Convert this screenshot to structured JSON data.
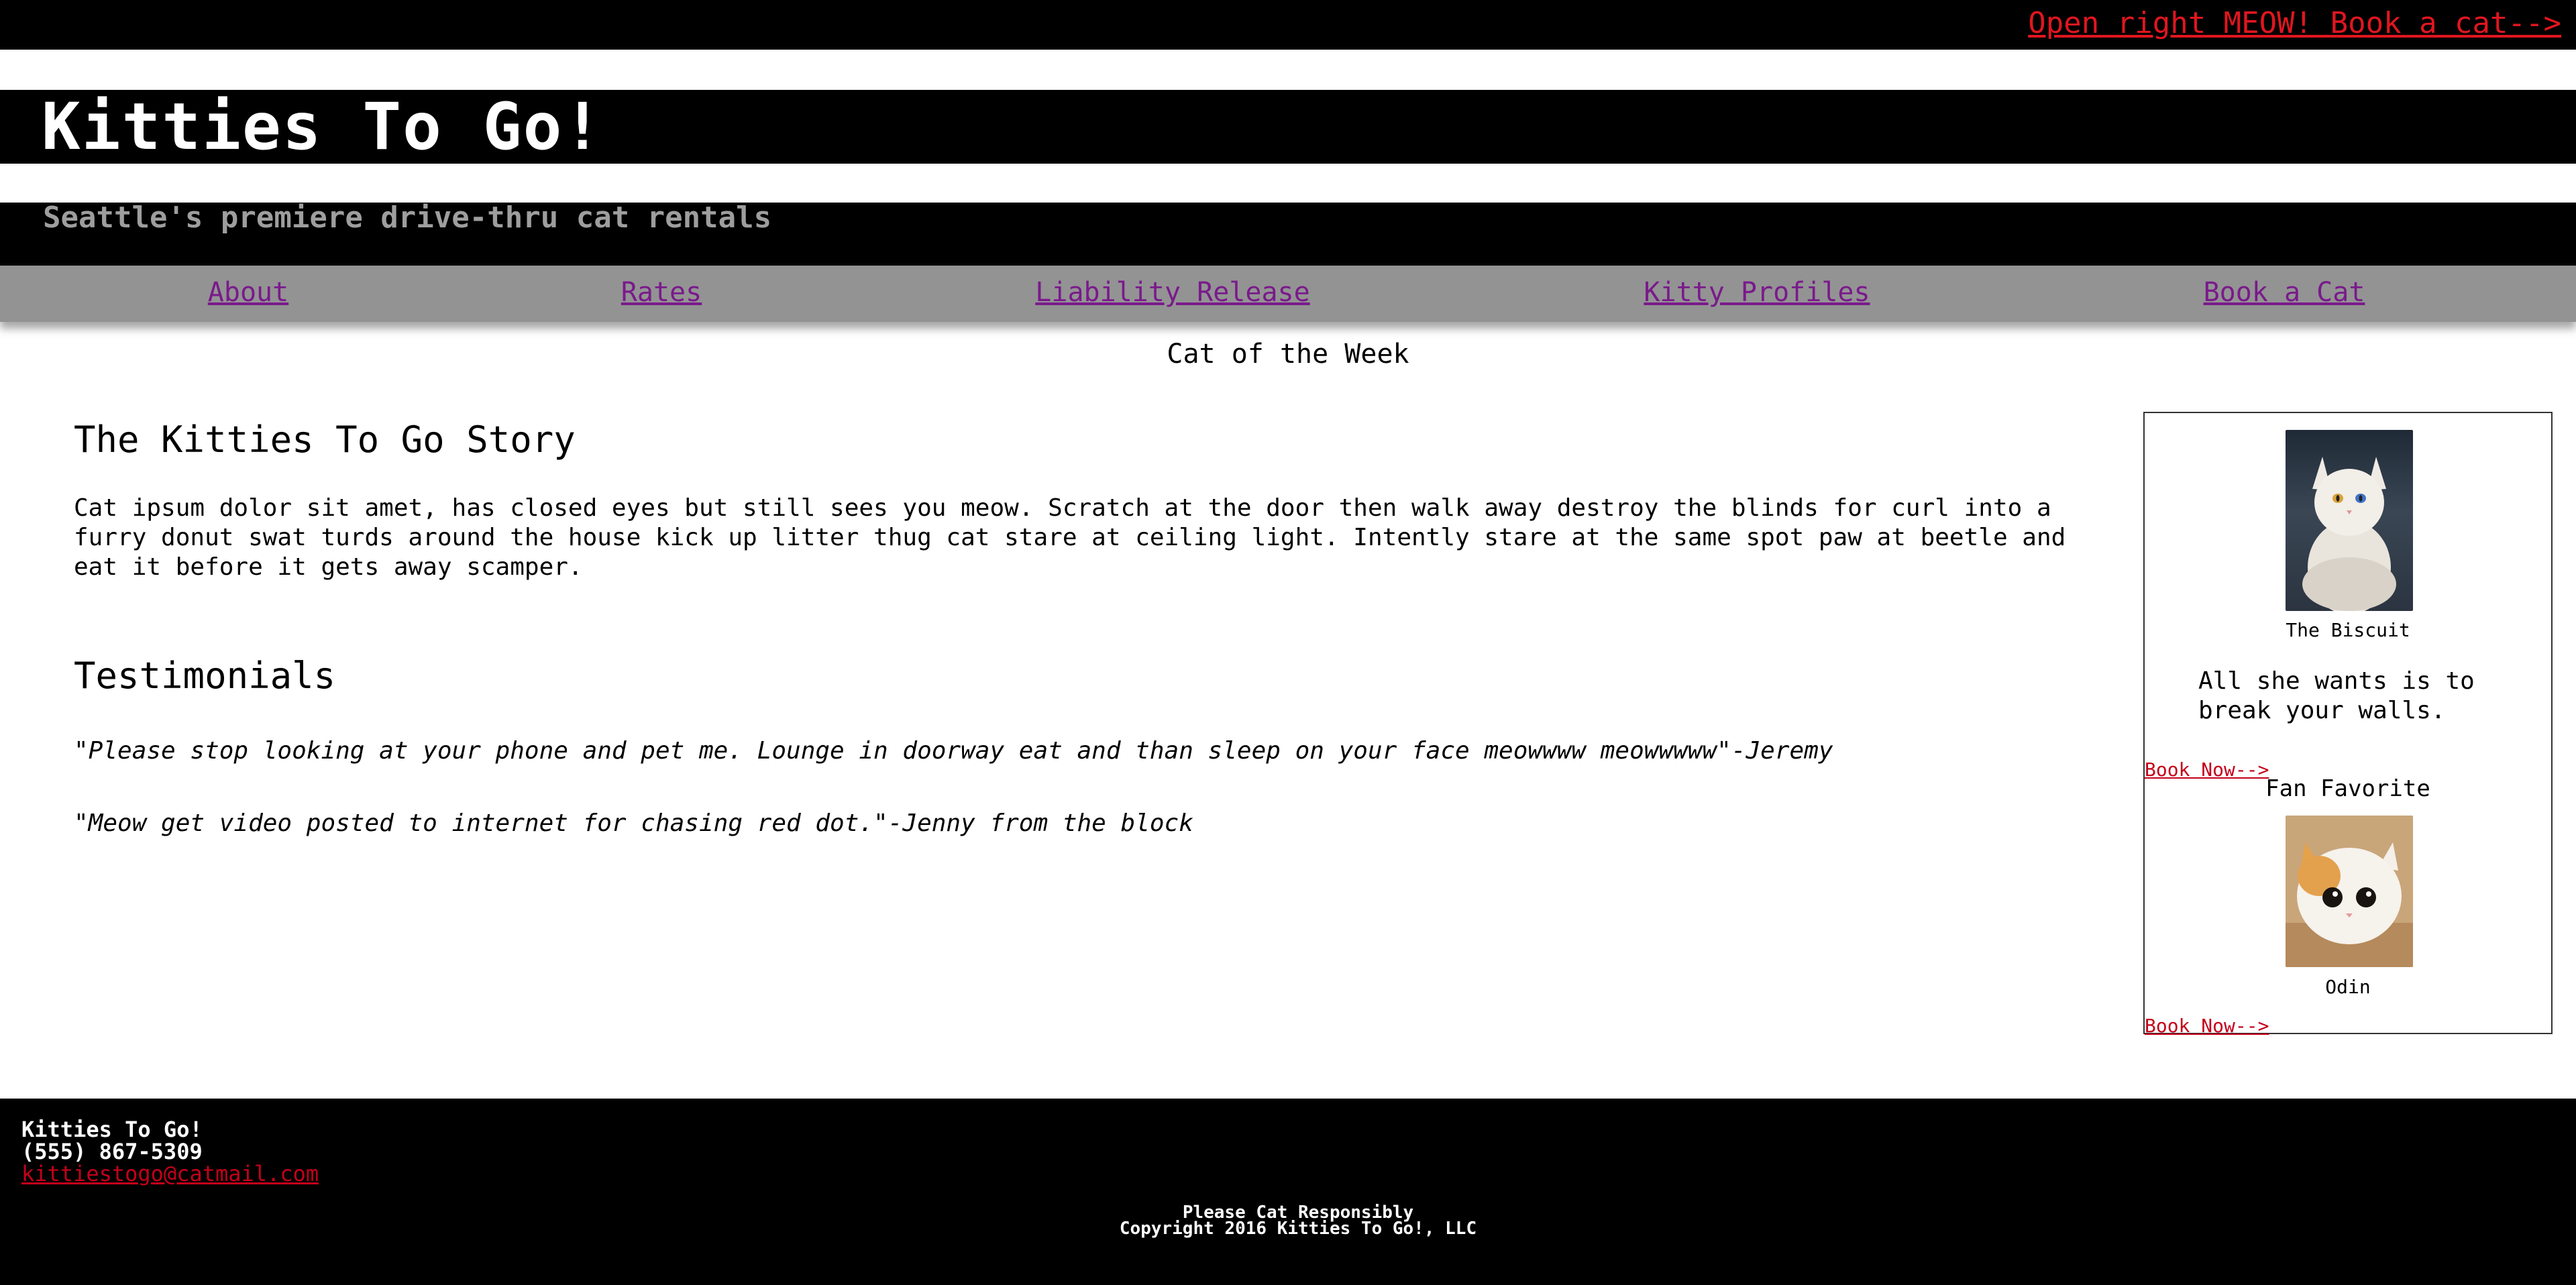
{
  "top_link": "Open right MEOW! Book a cat-->",
  "site": {
    "title": "Kitties To Go!",
    "tagline": "Seattle's premiere drive-thru cat rentals"
  },
  "nav": {
    "items": [
      {
        "label": "About"
      },
      {
        "label": "Rates"
      },
      {
        "label": "Liability Release"
      },
      {
        "label": "Kitty Profiles"
      },
      {
        "label": "Book a Cat"
      }
    ]
  },
  "main": {
    "story_heading": "The Kitties To Go Story",
    "story_text": "Cat ipsum dolor sit amet, has closed eyes but still sees you meow. Scratch at the door then walk away destroy the blinds for curl into a furry donut swat turds around the house kick up litter thug cat stare at ceiling light. Intently stare at the same spot paw at beetle and eat it before it gets away scamper.",
    "testimonials_heading": "Testimonials",
    "testimonials": [
      {
        "text": "\"Please stop looking at your phone and pet me. Lounge in doorway eat and than sleep on your face meowwww meowwwww\"-Jeremy"
      },
      {
        "text": "\"Meow get video posted to internet for chasing red dot.\"-Jenny from the block"
      }
    ]
  },
  "aside": {
    "heading": "Cat of the Week",
    "cat_of_week": {
      "name": "The Biscuit",
      "blurb": "All she wants is to break your walls.",
      "book_label": "Book Now-->"
    },
    "fan_favorite": {
      "heading": "Fan Favorite",
      "name": "Odin",
      "book_label": "Book Now-->"
    }
  },
  "footer": {
    "name": "Kitties To Go!",
    "phone": "(555) 867-5309",
    "email": "kittiestogo@catmail.com",
    "slogan": "Please Cat Responsibly",
    "copyright": "Copyright 2016 Kitties To Go!, LLC"
  },
  "colors": {
    "bar_background": "#000000",
    "nav_background": "#939393",
    "link_red": "#e0161f",
    "nav_link_purple": "#7a1a8c",
    "tagline_gray": "#9e9e9e"
  }
}
